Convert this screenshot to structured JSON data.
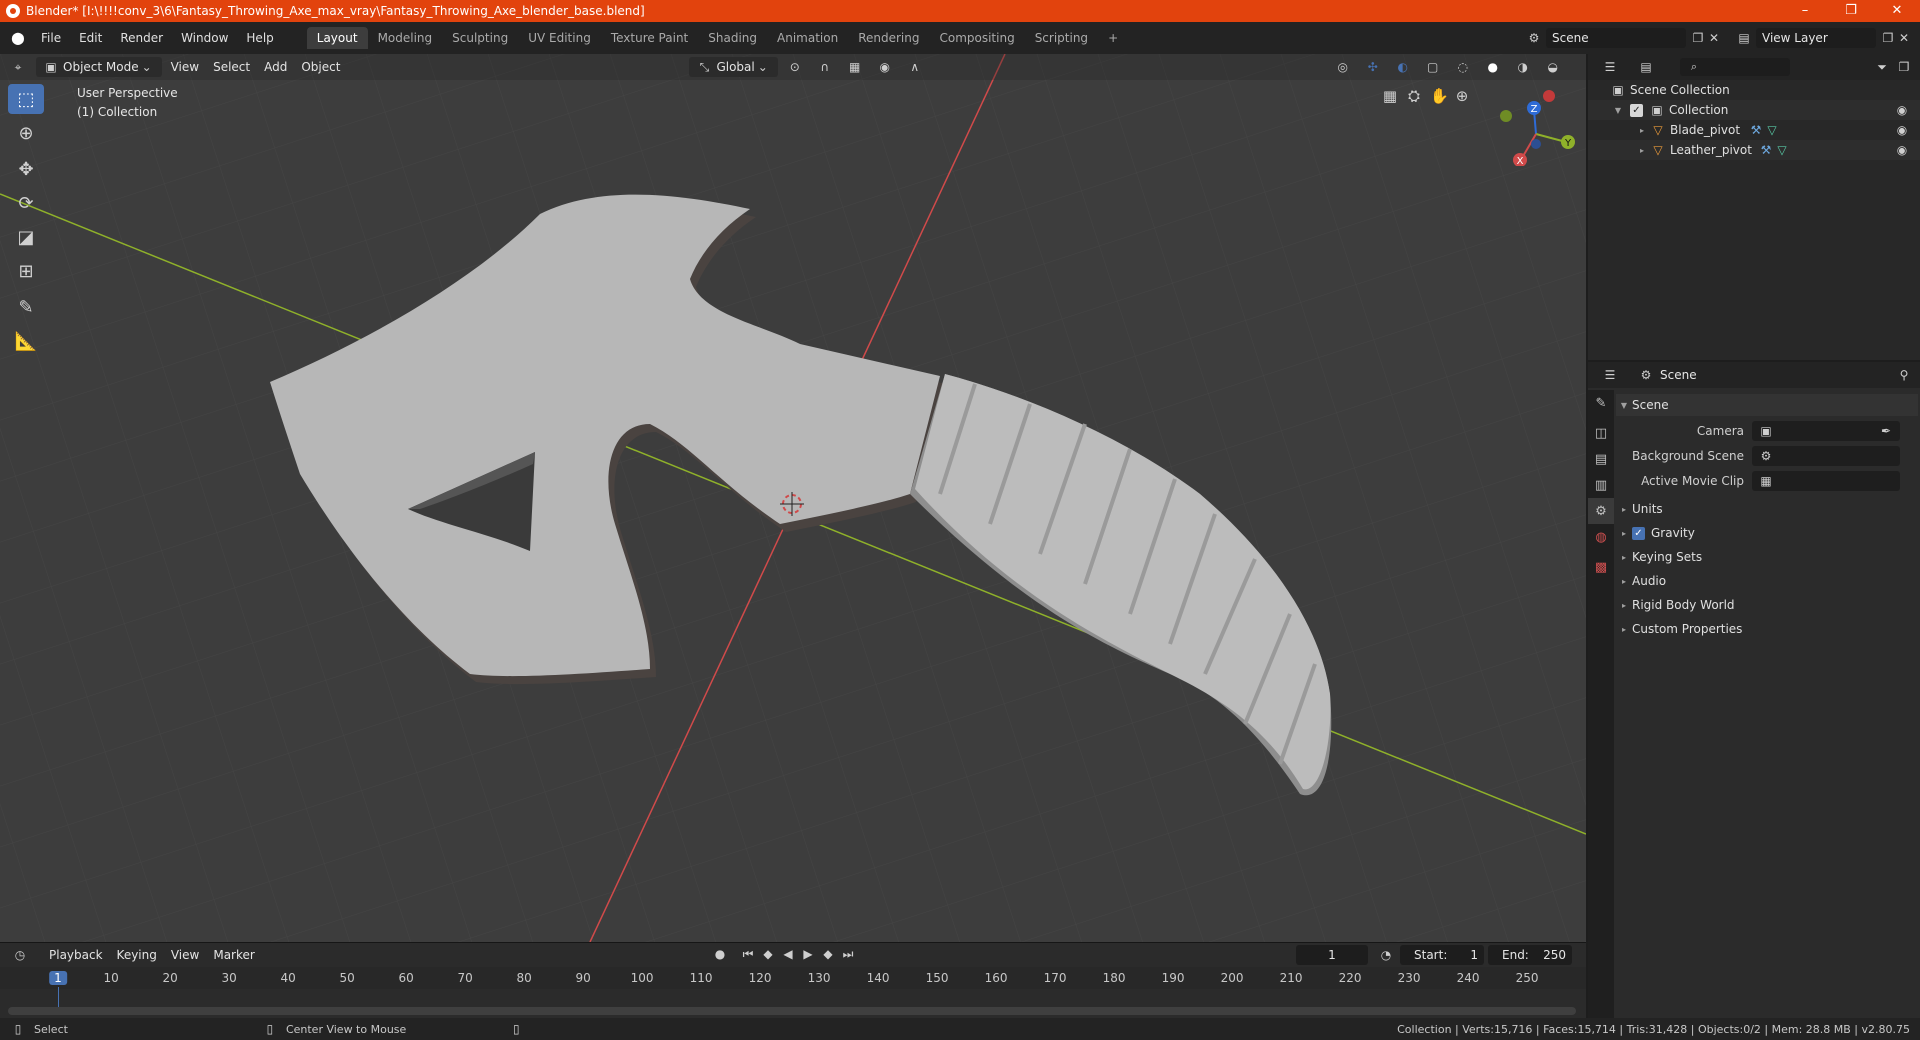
{
  "window": {
    "title": "Blender* [I:\\!!!!conv_3\\6\\Fantasy_Throwing_Axe_max_vray\\Fantasy_Throwing_Axe_blender_base.blend]",
    "minimize": "–",
    "maximize": "❐",
    "close": "✕"
  },
  "menu": [
    "File",
    "Edit",
    "Render",
    "Window",
    "Help"
  ],
  "workspaces": [
    "Layout",
    "Modeling",
    "Sculpting",
    "UV Editing",
    "Texture Paint",
    "Shading",
    "Animation",
    "Rendering",
    "Compositing",
    "Scripting"
  ],
  "workspace_add": "+",
  "scene_field": "Scene",
  "view_layer_field": "View Layer",
  "viewport": {
    "mode": "Object Mode",
    "menus": [
      "View",
      "Select",
      "Add",
      "Object"
    ],
    "orientation": "Global",
    "perspective_label": "User Perspective",
    "collection_label": "(1) Collection",
    "gizmo": {
      "x": "X",
      "y": "Y",
      "z": "Z"
    }
  },
  "tools": [
    "select-box",
    "cursor",
    "move",
    "rotate",
    "scale",
    "transform",
    "annotate",
    "measure"
  ],
  "timeline": {
    "menus": [
      "Playback",
      "Keying",
      "View",
      "Marker"
    ],
    "current_frame": "1",
    "start_label": "Start:",
    "start": "1",
    "end_label": "End:",
    "end": "250",
    "ticks": [
      "1",
      "10",
      "20",
      "30",
      "40",
      "50",
      "60",
      "70",
      "80",
      "90",
      "100",
      "110",
      "120",
      "130",
      "140",
      "150",
      "160",
      "170",
      "180",
      "190",
      "200",
      "210",
      "220",
      "230",
      "240",
      "250"
    ]
  },
  "statusbar": {
    "select": "Select",
    "center_view": "Center View to Mouse",
    "stats": "Collection | Verts:15,716 | Faces:15,714 | Tris:31,428 | Objects:0/2 | Mem: 28.8 MB | v2.80.75"
  },
  "outliner": {
    "scene_collection": "Scene Collection",
    "collection": "Collection",
    "objects": [
      "Blade_pivot",
      "Leather_pivot"
    ]
  },
  "properties": {
    "header": "Scene",
    "panel": "Scene",
    "camera_label": "Camera",
    "background_scene_label": "Background Scene",
    "active_movie_clip_label": "Active Movie Clip",
    "sections": [
      "Units",
      "Gravity",
      "Keying Sets",
      "Audio",
      "Rigid Body World",
      "Custom Properties"
    ]
  },
  "colors": {
    "titlebar": "#e2430d",
    "accent": "#4772b3",
    "viewport_bg": "#3d3d3d",
    "axe_surface": "#b7b7b7",
    "x_axis": "#d04a4a",
    "y_axis": "#8fb12a"
  }
}
